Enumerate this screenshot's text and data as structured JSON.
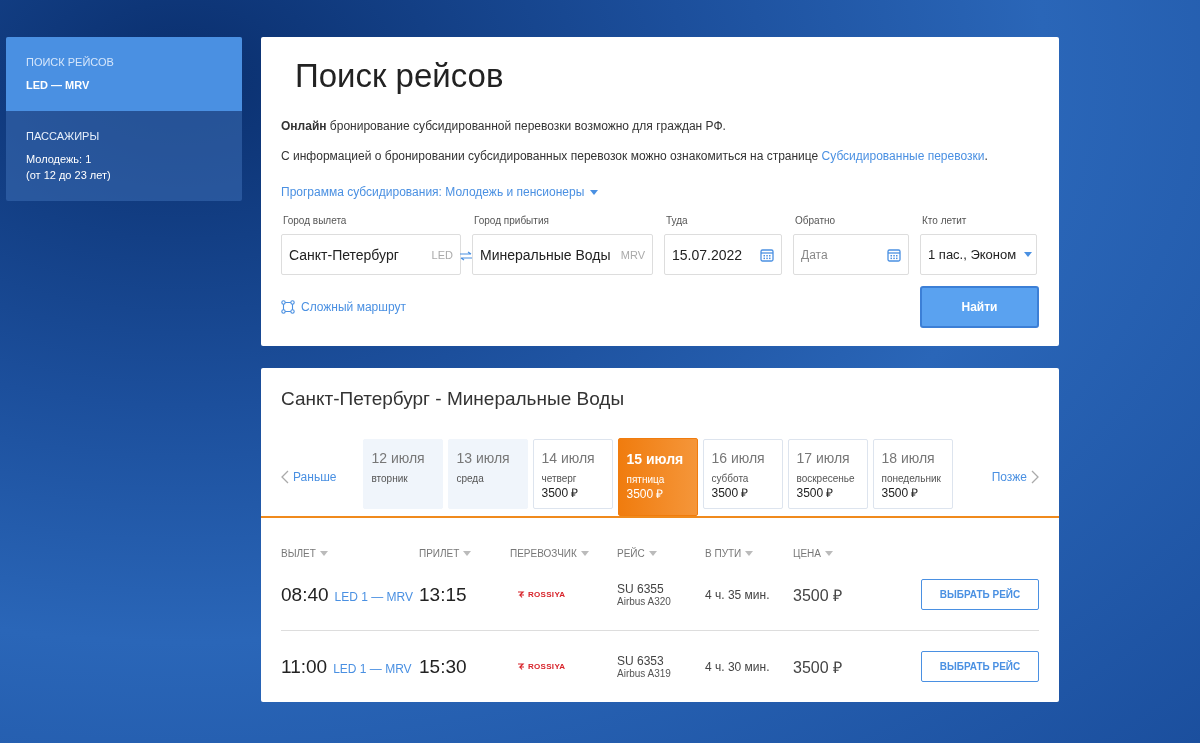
{
  "sidebar": {
    "items": [
      {
        "title": "ПОИСК РЕЙСОВ",
        "lines": [
          "LED — MRV"
        ],
        "selected": true
      },
      {
        "title": "ПАССАЖИРЫ",
        "lines": [
          "Молодежь: 1",
          "(от 12 до 23 лет)"
        ],
        "selected": false
      }
    ]
  },
  "search": {
    "title": "Поиск рейсов",
    "notice": "**Онлайн** бронирование субсидированной перевозки возможно для граждан РФ.",
    "info": {
      "text": "С информацией о бронировании субсидированных перевозок можно ознакомиться на странице",
      "link": "Субсидированные перевозки",
      "end": "."
    },
    "program": "Программа субсидирования: Молодежь и пенсионеры",
    "fields": [
      {
        "kind": "city",
        "label": "Город вылета",
        "value": "Санкт-Петербург",
        "code": "LED"
      },
      {
        "kind": "city",
        "label": "Город прибытия",
        "value": "Минеральные Воды",
        "code": "MRV"
      },
      {
        "kind": "date",
        "label": "Туда",
        "value": "15.07.2022"
      },
      {
        "kind": "date",
        "label": "Обратно",
        "placeholder": "Дата"
      },
      {
        "kind": "select",
        "label": "Кто летит",
        "value": "1 пас., Эконом"
      }
    ],
    "complex_route": "Сложный маршрут",
    "submit": "Найти"
  },
  "results": {
    "title": "Санкт-Петербург - Минеральные Воды",
    "earlier": "Раньше",
    "later": "Позже",
    "days": [
      {
        "date": "12 июля",
        "weekday": "вторник",
        "selected": false
      },
      {
        "date": "13 июля",
        "weekday": "среда",
        "selected": false
      },
      {
        "date": "14 июля",
        "weekday": "четверг",
        "price": "3500 ₽",
        "selected": false
      },
      {
        "date": "15 июля",
        "weekday": "пятница",
        "price": "3500 ₽",
        "selected": true
      },
      {
        "date": "16 июля",
        "weekday": "суббота",
        "price": "3500 ₽",
        "selected": false
      },
      {
        "date": "17 июля",
        "weekday": "воскресенье",
        "price": "3500 ₽",
        "selected": false
      },
      {
        "date": "18 июля",
        "weekday": "понедельник",
        "price": "3500 ₽",
        "selected": false
      }
    ],
    "columns": [
      "ВЫЛЕТ",
      "ПРИЛЕТ",
      "ПЕРЕВОЗЧИК",
      "РЕЙС",
      "В ПУТИ",
      "ЦЕНА"
    ],
    "flights": [
      {
        "departure": "08:40",
        "route": "LED 1 — MRV",
        "arrival": "13:15",
        "carrier": "ROSSIYA",
        "flight": "SU 6355",
        "aircraft": "Airbus A320",
        "duration": "4 ч. 35 мин.",
        "price": "3500 ₽",
        "action": "ВЫБРАТЬ РЕЙС"
      },
      {
        "departure": "11:00",
        "route": "LED 1 — MRV",
        "arrival": "15:30",
        "carrier": "ROSSIYA",
        "flight": "SU 6353",
        "aircraft": "Airbus A319",
        "duration": "4 ч. 30 мин.",
        "price": "3500 ₽",
        "action": "ВЫБРАТЬ РЕЙС"
      }
    ]
  }
}
